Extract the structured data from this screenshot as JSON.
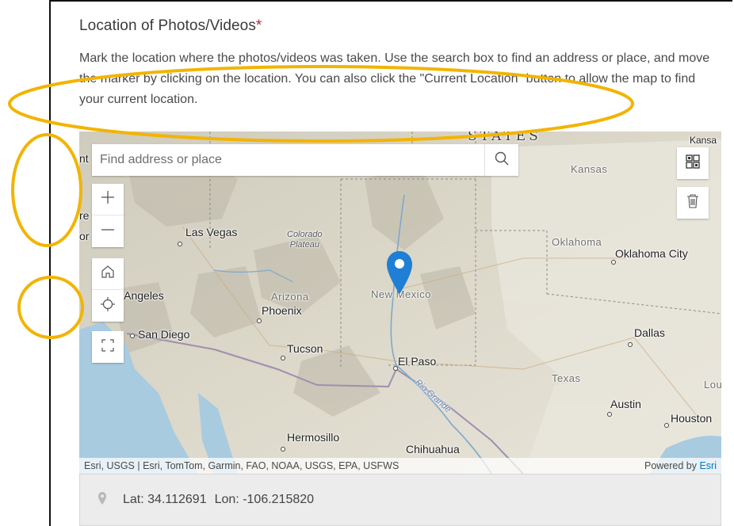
{
  "form": {
    "title": "Location of Photos/Videos",
    "required_mark": "*",
    "description": "Mark the location where the photos/videos was taken. Use the search box to find an address or place, and move the marker by clicking on the location. You can also click the \"Current Location\" button to allow the map to find your current location."
  },
  "map": {
    "search": {
      "placeholder": "Find address or place"
    },
    "labels": {
      "states_big": "STATES",
      "kansas_partial": "Kansa",
      "kansas": "Kansas",
      "oklahoma": "Oklahoma",
      "oklahoma_city": "Oklahoma City",
      "las_vegas": "Las Vegas",
      "colorado_plateau": "Colorado\nPlateau",
      "new_mexico": "New Mexico",
      "arizona": "Arizona",
      "phoenix": "Phoenix",
      "los_angeles": "s Angeles",
      "san_diego": "San Diego",
      "tucson": "Tucson",
      "el_paso": "El Paso",
      "dallas": "Dallas",
      "texas": "Texas",
      "austin": "Austin",
      "houston": "Houston",
      "hermosillo": "Hermosillo",
      "chihuahua": "Chihuahua",
      "rio_grande": "Rio Grande",
      "lou": "Lou",
      "edge_nt": "nt",
      "edge_re": "re",
      "edge_or": "or"
    },
    "attribution": {
      "sources": "Esri, USGS | Esri, TomTom, Garmin, FAO, NOAA, USGS, EPA, USFWS",
      "powered_prefix": "Powered by ",
      "powered_brand": "Esri"
    },
    "colors": {
      "accent": "#0079c1",
      "marker": "#1e7fd4",
      "annotation": "#f2b400"
    },
    "icons": [
      "search-icon",
      "zoom-in-icon",
      "zoom-out-icon",
      "home-icon",
      "locate-icon",
      "fullscreen-icon",
      "basemap-gallery-icon",
      "trash-icon",
      "map-pin-icon"
    ]
  },
  "coordinates": {
    "lat_label": "Lat:",
    "lat_value": "34.112691",
    "lon_label": "Lon:",
    "lon_value": "-106.215820"
  }
}
